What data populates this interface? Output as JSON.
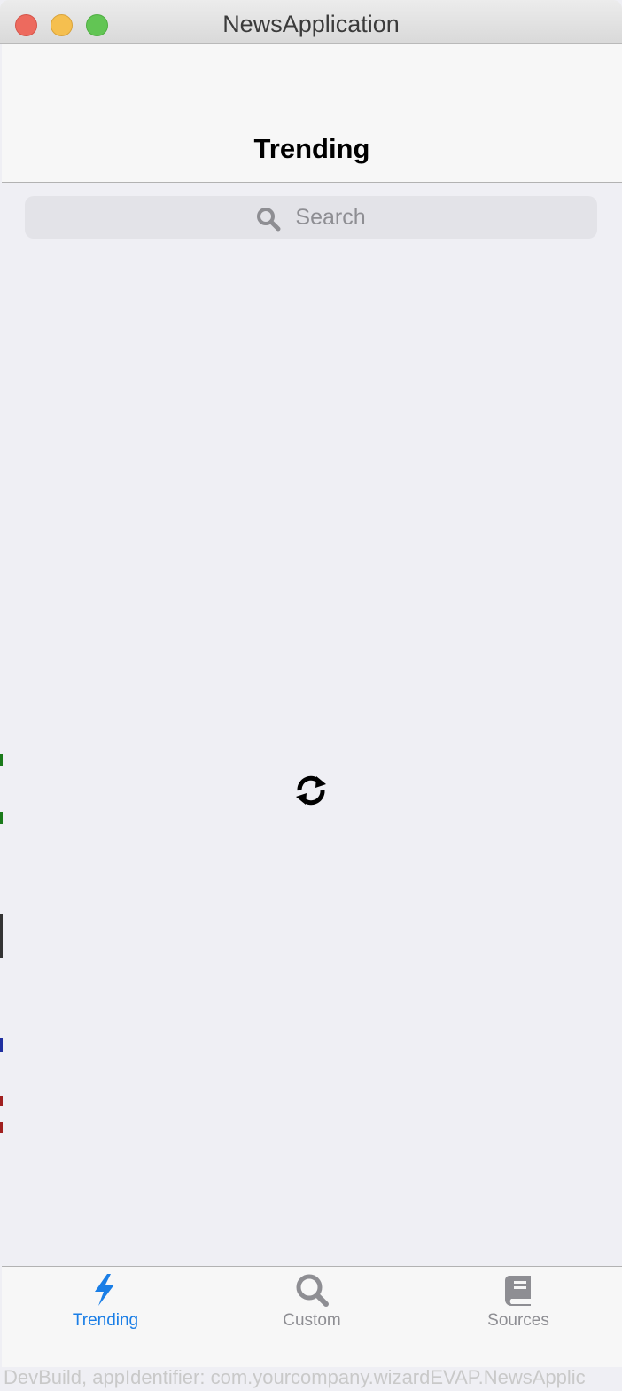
{
  "window": {
    "title": "NewsApplication"
  },
  "navbar": {
    "title": "Trending"
  },
  "search": {
    "placeholder": "Search",
    "icon": "search-icon"
  },
  "content": {
    "loading_icon": "refresh-spinner-icon"
  },
  "tabbar": {
    "tabs": [
      {
        "label": "Trending",
        "icon": "bolt-icon",
        "active": true
      },
      {
        "label": "Custom",
        "icon": "search-icon",
        "active": false
      },
      {
        "label": "Sources",
        "icon": "book-icon",
        "active": false
      }
    ]
  },
  "footer": {
    "devbuild": "DevBuild, appIdentifier: com.yourcompany.wizardEVAP.NewsApplic"
  },
  "colors": {
    "accent": "#1a7ee6",
    "inactive": "#8e8e93",
    "background": "#efeff4",
    "bar_background": "#f7f7f7"
  }
}
